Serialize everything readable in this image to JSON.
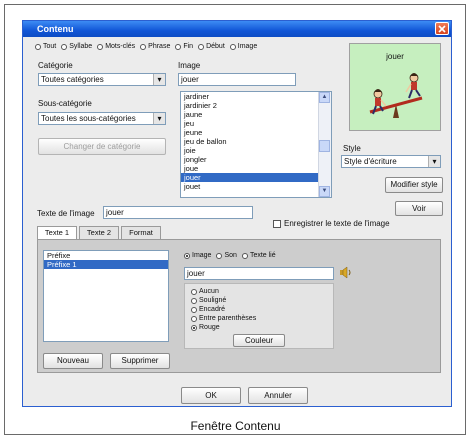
{
  "window": {
    "title": "Contenu",
    "close_icon": "close-icon"
  },
  "modes": [
    {
      "label": "Tout",
      "selected": false
    },
    {
      "label": "Syllabe",
      "selected": false
    },
    {
      "label": "Mots-clés",
      "selected": false
    },
    {
      "label": "Phrase",
      "selected": false
    },
    {
      "label": "Fin",
      "selected": false
    },
    {
      "label": "Début",
      "selected": false
    },
    {
      "label": "Image",
      "selected": false
    }
  ],
  "preview": {
    "word": "jouer",
    "icon": "seesaw-pictogram",
    "background": "#c6efbf"
  },
  "category": {
    "label": "Catégorie",
    "value": "Toutes catégories"
  },
  "subcategory": {
    "label": "Sous-catégorie",
    "value": "Toutes les sous-catégories"
  },
  "change_category_button": "Changer de catégorie",
  "image": {
    "label": "Image",
    "value": "jouer",
    "list": [
      "jardiner",
      "jardinier 2",
      "jaune",
      "jeu",
      "jeune",
      "jeu de ballon",
      "joie",
      "jongler",
      "joue",
      "jouer",
      "jouet"
    ],
    "selected_index": 9
  },
  "style": {
    "label": "Style",
    "value": "Style d'écriture",
    "modify_button": "Modifier style",
    "view_button": "Voir"
  },
  "image_text": {
    "label": "Texte de l'image",
    "value": "jouer"
  },
  "keep_text_checkbox": {
    "label": "Enregistrer le texte de l'image",
    "checked": false
  },
  "tabs": [
    {
      "label": "Texte 1",
      "active": true
    },
    {
      "label": "Texte 2",
      "active": false
    },
    {
      "label": "Format",
      "active": false
    }
  ],
  "tab_panel": {
    "list_items": [
      "Préfixe",
      "Préfixe 1"
    ],
    "list_selected_index": 1,
    "new_button": "Nouveau",
    "delete_button": "Supprimer",
    "type_options": [
      {
        "label": "Image",
        "selected": true
      },
      {
        "label": "Son",
        "selected": false
      },
      {
        "label": "Texte lié",
        "selected": false
      }
    ],
    "value": "jouer",
    "sound_icon": "speaker-icon",
    "style_options": [
      {
        "label": "Aucun",
        "selected": false
      },
      {
        "label": "Souligné",
        "selected": false
      },
      {
        "label": "Encadré",
        "selected": false
      },
      {
        "label": "Entre parenthèses",
        "selected": false
      },
      {
        "label": "Rouge",
        "selected": true
      }
    ],
    "color_button": "Couleur"
  },
  "ok_button": "OK",
  "cancel_button": "Annuler",
  "caption": "Fenêtre Contenu",
  "colors": {
    "title_bar": "#1156d6",
    "selection": "#316ac5",
    "close": "#d8451f"
  }
}
